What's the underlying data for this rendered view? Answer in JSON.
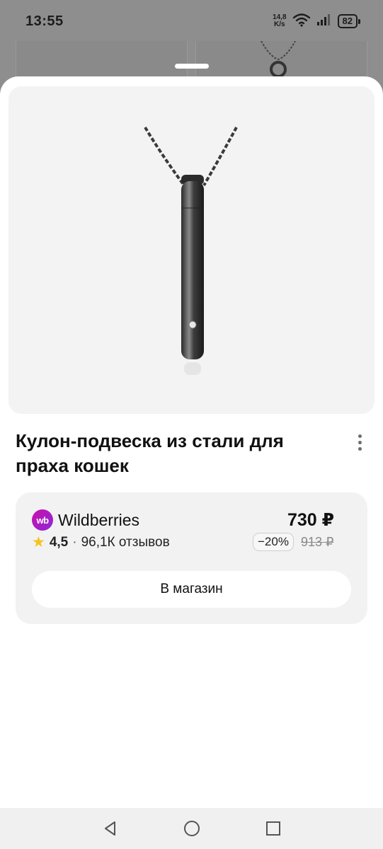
{
  "status_bar": {
    "time": "13:55",
    "net_speed_value": "14,8",
    "net_speed_unit": "K/s",
    "battery": "82",
    "icons": [
      "wifi-icon",
      "signal-icon",
      "battery-icon"
    ]
  },
  "product": {
    "image_icon": "pendant-image",
    "title": "Кулон-подвеска из стали для праха кошек"
  },
  "offer": {
    "store_logo_text": "wb",
    "store_name": "Wildberries",
    "rating": "4,5",
    "separator": "·",
    "reviews": "96,1К отзывов",
    "price": "730 ₽",
    "discount": "−20%",
    "old_price": "913 ₽",
    "button_label": "В магазин"
  },
  "colors": {
    "wb_brand": "#cb11ab",
    "star": "#f6c31a",
    "card_bg": "#f2f2f2"
  },
  "nav_bar": {
    "icons": [
      "back-icon",
      "home-icon",
      "recents-icon"
    ]
  }
}
